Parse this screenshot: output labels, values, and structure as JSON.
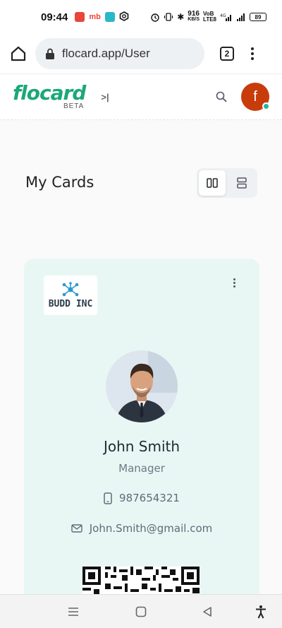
{
  "status_bar": {
    "time": "09:44",
    "app_badges": [
      "mb"
    ],
    "net_speed_top": "916",
    "net_speed_bottom": "KB/S",
    "network_top": "VoB",
    "network_bottom": "LTE8",
    "signal": "4G",
    "battery": "89"
  },
  "browser": {
    "url": "flocard.app/User",
    "tab_count": "2"
  },
  "app_header": {
    "logo_text": "flocard",
    "logo_badge": "BETA",
    "collapse_glyph": ">|",
    "avatar_initial": "f",
    "avatar_color": "#c83c0c",
    "online_color": "#27b3a0"
  },
  "main": {
    "title": "My Cards",
    "view_toggle": {
      "active": "grid",
      "options": [
        "grid",
        "list"
      ]
    }
  },
  "card": {
    "company_name": "BUDD INC",
    "person_name": "John Smith",
    "role": "Manager",
    "phone": "987654321",
    "email": "John.Smith@gmail.com",
    "background": "#e8f7f4"
  },
  "colors": {
    "brand": "#1ba877",
    "text_muted": "#6b7a86"
  },
  "icons": {
    "home": "home-icon",
    "lock": "lock-icon",
    "search": "search-icon",
    "phone": "phone-icon",
    "mail": "mail-icon",
    "more": "more-vertical-icon",
    "nav_menu": "menu-icon",
    "nav_home": "square-icon",
    "nav_back": "triangle-back-icon",
    "nav_accessibility": "accessibility-icon"
  }
}
